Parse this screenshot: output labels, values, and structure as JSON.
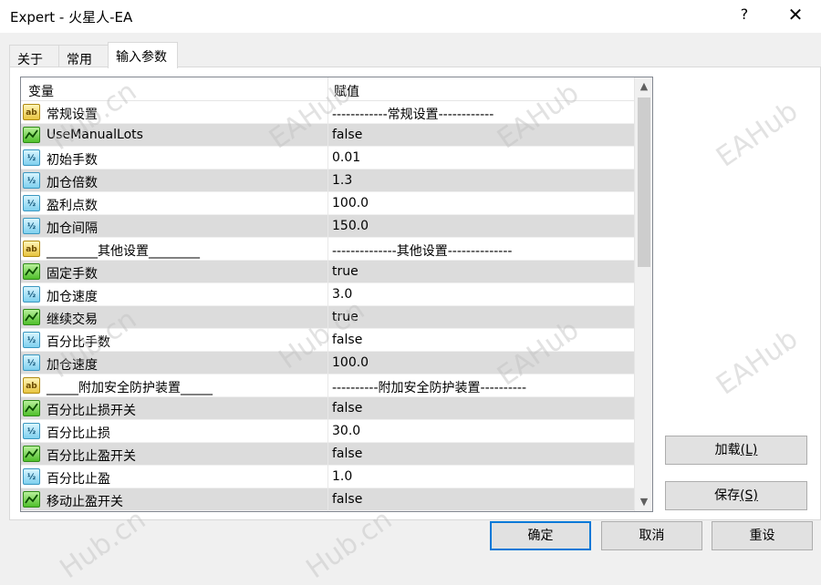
{
  "window": {
    "title": "Expert - 火星人-EA",
    "help": "?",
    "close": "✕"
  },
  "tabs": [
    {
      "label": "关于"
    },
    {
      "label": "常用"
    },
    {
      "label": "输入参数"
    }
  ],
  "grid": {
    "columns": [
      "变量",
      "赋值"
    ],
    "rows": [
      {
        "icon": "ab",
        "name": "常规设置",
        "value": "------------常规设置------------"
      },
      {
        "icon": "bool",
        "name": "UseManualLots",
        "value": "false"
      },
      {
        "icon": "num",
        "name": "初始手数",
        "value": "0.01"
      },
      {
        "icon": "num",
        "name": "加仓倍数",
        "value": "1.3"
      },
      {
        "icon": "num",
        "name": "盈利点数",
        "value": "100.0"
      },
      {
        "icon": "num",
        "name": "加仓间隔",
        "value": "150.0"
      },
      {
        "icon": "ab",
        "name": "________其他设置________",
        "value": "--------------其他设置--------------"
      },
      {
        "icon": "bool",
        "name": "固定手数",
        "value": "true"
      },
      {
        "icon": "num",
        "name": "加仓速度",
        "value": "3.0"
      },
      {
        "icon": "bool",
        "name": "继续交易",
        "value": "true"
      },
      {
        "icon": "num",
        "name": "百分比手数",
        "value": "false"
      },
      {
        "icon": "num",
        "name": "加仓速度",
        "value": "100.0"
      },
      {
        "icon": "ab",
        "name": "_____附加安全防护装置_____",
        "value": "----------附加安全防护装置----------"
      },
      {
        "icon": "bool",
        "name": "百分比止损开关",
        "value": "false"
      },
      {
        "icon": "num",
        "name": "百分比止损",
        "value": "30.0"
      },
      {
        "icon": "bool",
        "name": "百分比止盈开关",
        "value": "false"
      },
      {
        "icon": "num",
        "name": "百分比止盈",
        "value": "1.0"
      },
      {
        "icon": "bool",
        "name": "移动止盈开关",
        "value": "false"
      }
    ]
  },
  "icons": {
    "ab": "ab",
    "bool": "",
    "num": "½"
  },
  "buttons": {
    "load": {
      "label": "加载",
      "mnemonic": "(L)"
    },
    "save": {
      "label": "保存",
      "mnemonic": "(S)"
    },
    "ok": "确定",
    "cancel": "取消",
    "reset": "重设"
  },
  "scroll": {
    "up": "▲",
    "down": "▼"
  },
  "watermark": {
    "text1": "EAHub",
    "text2": "Hub.cn"
  }
}
